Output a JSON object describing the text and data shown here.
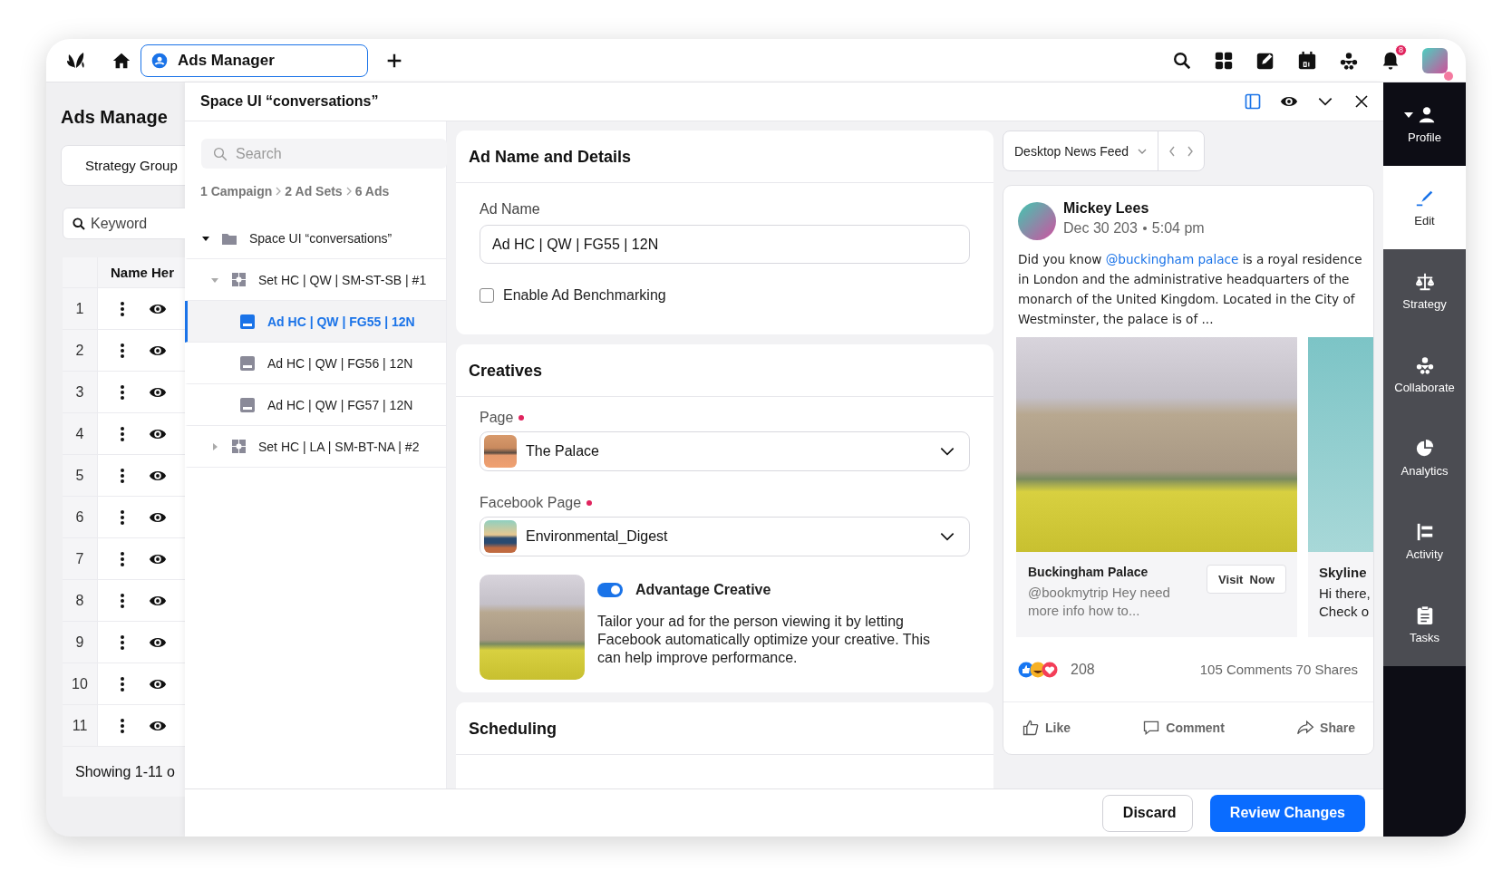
{
  "top_bar": {
    "tab": {
      "label": "Ads Manager",
      "selected": true
    },
    "notification_count": "8"
  },
  "background_page": {
    "title": "Ads Manage",
    "filter_chip": "Strategy Group",
    "keyword_field": {
      "placeholder": "Keyword"
    },
    "column_header": "Name Her",
    "rows": [
      "1",
      "2",
      "3",
      "4",
      "5",
      "6",
      "7",
      "8",
      "9",
      "10",
      "11"
    ],
    "footer": "Showing 1-11 o"
  },
  "drawer": {
    "title": "Space UI “conversations”",
    "search": {
      "placeholder": "Search"
    },
    "breadcrumb": [
      "1 Campaign",
      "2 Ad Sets",
      "6 Ads"
    ],
    "tree": [
      {
        "label": "Space UI “conversations”",
        "kind": "campaign",
        "expanded": true,
        "selected": false,
        "children": [
          {
            "label": "Set HC | QW | SM-ST-SB | #1",
            "kind": "ad_set",
            "expanded": true,
            "selected": false,
            "children": [
              {
                "label": "Ad HC | QW | FG55 | 12N",
                "kind": "ad",
                "selected": true
              },
              {
                "label": "Ad HC | QW | FG56 | 12N",
                "kind": "ad",
                "selected": false
              },
              {
                "label": "Ad HC | QW | FG57 | 12N",
                "kind": "ad",
                "selected": false
              }
            ]
          },
          {
            "label": "Set HC | LA | SM-BT-NA | #2",
            "kind": "ad_set",
            "expanded": false,
            "selected": false
          }
        ]
      }
    ],
    "ad_details": {
      "title": "Ad Name and Details",
      "ad_name_label": "Ad Name",
      "ad_name_value": "Ad HC | QW | FG55 | 12N",
      "benchmark": {
        "label": "Enable Ad Benchmarking",
        "checked": false
      }
    },
    "creatives": {
      "title": "Creatives",
      "fields": [
        {
          "label": "Page",
          "required": true,
          "value": "The Palace"
        },
        {
          "label": "Facebook Page",
          "required": true,
          "value": "Environmental_Digest"
        }
      ],
      "advantage": {
        "label": "Advantage Creative",
        "on": true,
        "description": "Tailor your ad for the person viewing it by letting Facebook automatically optimize your creative. This can help improve performance."
      }
    },
    "scheduling": {
      "title": "Scheduling"
    },
    "preview": {
      "placement": "Desktop News Feed",
      "author": "Mickey Lees",
      "date": "Dec 30 203",
      "time": "5:04 pm",
      "text_before": "Did you know ",
      "mention": "@buckingham palace",
      "text_after": " is a royal residence in London and the administrative headquarters of the monarch of the United Kingdom. Located in the City of Westminster, the palace is of ...",
      "carousel": [
        {
          "title": "Buckingham Palace",
          "description": "@bookmytrip Hey need more info how to...",
          "button": "Visit  Now"
        },
        {
          "title": "Skyline",
          "description": "Hi there, Check o"
        }
      ],
      "reactions_count": "208",
      "engagement": "105 Comments 70 Shares",
      "actions": [
        "Like",
        "Comment",
        "Share"
      ]
    },
    "footer_buttons": [
      {
        "label": "Discard",
        "kind": "secondary"
      },
      {
        "label": "Review Changes",
        "kind": "primary"
      }
    ]
  },
  "rail": [
    {
      "label": "Profile",
      "kind": "profile",
      "selected": false
    },
    {
      "label": "Edit",
      "kind": "tool",
      "selected": true
    },
    {
      "label": "Strategy",
      "kind": "tool",
      "selected": false
    },
    {
      "label": "Collaborate",
      "kind": "tool",
      "selected": false
    },
    {
      "label": "Analytics",
      "kind": "tool",
      "selected": false
    },
    {
      "label": "Activity",
      "kind": "tool",
      "selected": false
    },
    {
      "label": "Tasks",
      "kind": "tool",
      "selected": false
    }
  ]
}
